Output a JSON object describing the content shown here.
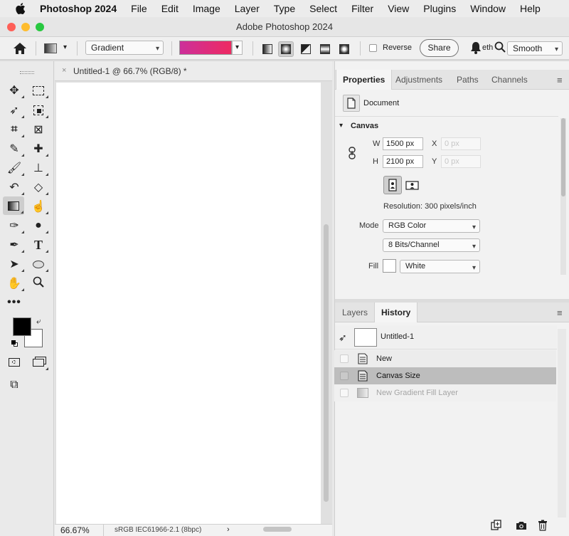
{
  "menubar": {
    "app_name": "Photoshop 2024",
    "items": [
      "File",
      "Edit",
      "Image",
      "Layer",
      "Type",
      "Select",
      "Filter",
      "View",
      "Plugins",
      "Window",
      "Help"
    ]
  },
  "window": {
    "title": "Adobe Photoshop 2024"
  },
  "options_bar": {
    "tool_preset": "Gradient",
    "gradient_colors": [
      "#cc2f9a",
      "#ee2a62"
    ],
    "reverse_label": "Reverse",
    "share_label": "Share",
    "method_partial": "eth",
    "method_value": "Smooth"
  },
  "document": {
    "tab_title": "Untitled-1 @ 66.7% (RGB/8) *",
    "zoom": "66.67%",
    "color_profile": "sRGB IEC61966-2.1 (8bpc)"
  },
  "properties": {
    "tabs": [
      "Properties",
      "Adjustments",
      "Paths",
      "Channels"
    ],
    "active_tab": "Properties",
    "doc_label": "Document",
    "canvas_label": "Canvas",
    "w_label": "W",
    "h_label": "H",
    "x_label": "X",
    "y_label": "Y",
    "width": "1500 px",
    "height": "2100 px",
    "x_value": "0 px",
    "y_value": "0 px",
    "resolution": "Resolution: 300 pixels/inch",
    "mode_label": "Mode",
    "mode_value": "RGB Color",
    "bits_value": "8 Bits/Channel",
    "fill_label": "Fill",
    "fill_value": "White"
  },
  "history": {
    "tabs": [
      "Layers",
      "History"
    ],
    "active_tab": "History",
    "snapshot": "Untitled-1",
    "steps": [
      "New",
      "Canvas Size",
      "New Gradient Fill Layer"
    ],
    "current_step": "Canvas Size"
  }
}
